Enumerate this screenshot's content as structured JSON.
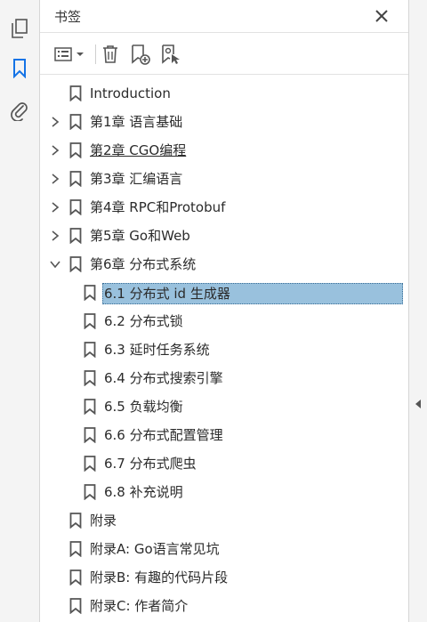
{
  "panel": {
    "title": "书签"
  },
  "rail": {
    "icons": [
      "pages-icon",
      "bookmark-icon",
      "attachment-icon"
    ]
  },
  "toolbar": {
    "icons": [
      "options-menu-icon",
      "delete-icon",
      "new-bookmark-icon",
      "new-bookmark-from-structure-icon"
    ]
  },
  "bookmarks": [
    {
      "label": "Introduction",
      "level": 0,
      "expander": "none"
    },
    {
      "label": "第1章 语言基础",
      "level": 0,
      "expander": "collapsed"
    },
    {
      "label": "第2章 CGO编程",
      "level": 0,
      "expander": "collapsed"
    },
    {
      "label": "第3章 汇编语言",
      "level": 0,
      "expander": "collapsed"
    },
    {
      "label": "第4章 RPC和Protobuf",
      "level": 0,
      "expander": "collapsed"
    },
    {
      "label": "第5章 Go和Web",
      "level": 0,
      "expander": "collapsed"
    },
    {
      "label": "第6章 分布式系统",
      "level": 0,
      "expander": "expanded"
    },
    {
      "label": "6.1 分布式 id 生成器",
      "level": 1,
      "expander": "none"
    },
    {
      "label": "6.2 分布式锁",
      "level": 1,
      "expander": "none"
    },
    {
      "label": "6.3 延时任务系统",
      "level": 1,
      "expander": "none"
    },
    {
      "label": "6.4 分布式搜索引擎",
      "level": 1,
      "expander": "none"
    },
    {
      "label": "6.5 负载均衡",
      "level": 1,
      "expander": "none"
    },
    {
      "label": "6.6 分布式配置管理",
      "level": 1,
      "expander": "none"
    },
    {
      "label": "6.7 分布式爬虫",
      "level": 1,
      "expander": "none"
    },
    {
      "label": "6.8 补充说明",
      "level": 1,
      "expander": "none"
    },
    {
      "label": "附录",
      "level": 0,
      "expander": "none"
    },
    {
      "label": "附录A: Go语言常见坑",
      "level": 0,
      "expander": "none"
    },
    {
      "label": "附录B: 有趣的代码片段",
      "level": 0,
      "expander": "none"
    },
    {
      "label": "附录C: 作者简介",
      "level": 0,
      "expander": "none"
    }
  ],
  "selected_bookmark": "6.1 分布式 id 生成器",
  "colors": {
    "accent": "#1473e6",
    "selection": "#99c1dd",
    "icon": "#555555"
  }
}
